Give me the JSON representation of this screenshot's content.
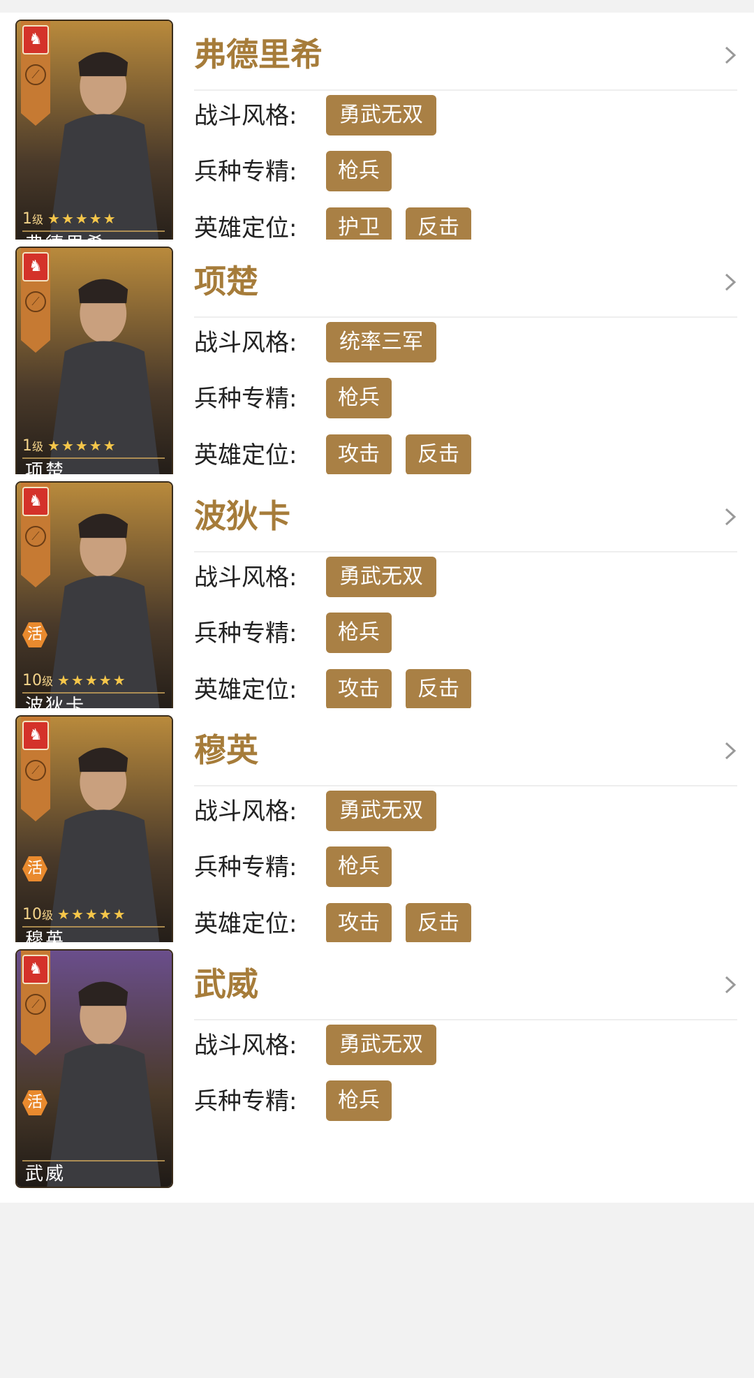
{
  "labels": {
    "combat_style": "战斗风格:",
    "troop_spec": "兵种专精:",
    "hero_role": "英雄定位:"
  },
  "heroes": [
    {
      "name": "弗德里希",
      "level": "1",
      "level_unit": "级",
      "stars": "★★★★★",
      "badge": "",
      "combat_style": "勇武无双",
      "troop_spec": "枪兵",
      "roles": [
        "护卫",
        "反击"
      ],
      "portrait_bg": "#b98a3c"
    },
    {
      "name": "项楚",
      "level": "1",
      "level_unit": "级",
      "stars": "★★★★★",
      "badge": "",
      "combat_style": "统率三军",
      "troop_spec": "枪兵",
      "roles": [
        "攻击",
        "反击"
      ],
      "portrait_bg": "#b98a3c"
    },
    {
      "name": "波狄卡",
      "level": "10",
      "level_unit": "级",
      "stars": "★★★★★",
      "badge": "活",
      "combat_style": "勇武无双",
      "troop_spec": "枪兵",
      "roles": [
        "攻击",
        "反击"
      ],
      "portrait_bg": "#b98a3c"
    },
    {
      "name": "穆英",
      "level": "10",
      "level_unit": "级",
      "stars": "★★★★★",
      "badge": "活",
      "combat_style": "勇武无双",
      "troop_spec": "枪兵",
      "roles": [
        "攻击",
        "反击"
      ],
      "portrait_bg": "#b98a3c"
    },
    {
      "name": "武威",
      "level": "",
      "level_unit": "",
      "stars": "",
      "badge": "活",
      "combat_style": "勇武无双",
      "troop_spec": "枪兵",
      "roles": [],
      "portrait_bg": "#6a4e8c"
    }
  ],
  "colors": {
    "accent": "#a67c3a",
    "tag_bg": "#a98045",
    "page_bg": "#f2f2f2",
    "card_bg": "#ffffff"
  },
  "icons": {
    "chevron": "chevron-right-icon",
    "emblem": "lion-crest-icon",
    "class": "spear-class-icon"
  }
}
